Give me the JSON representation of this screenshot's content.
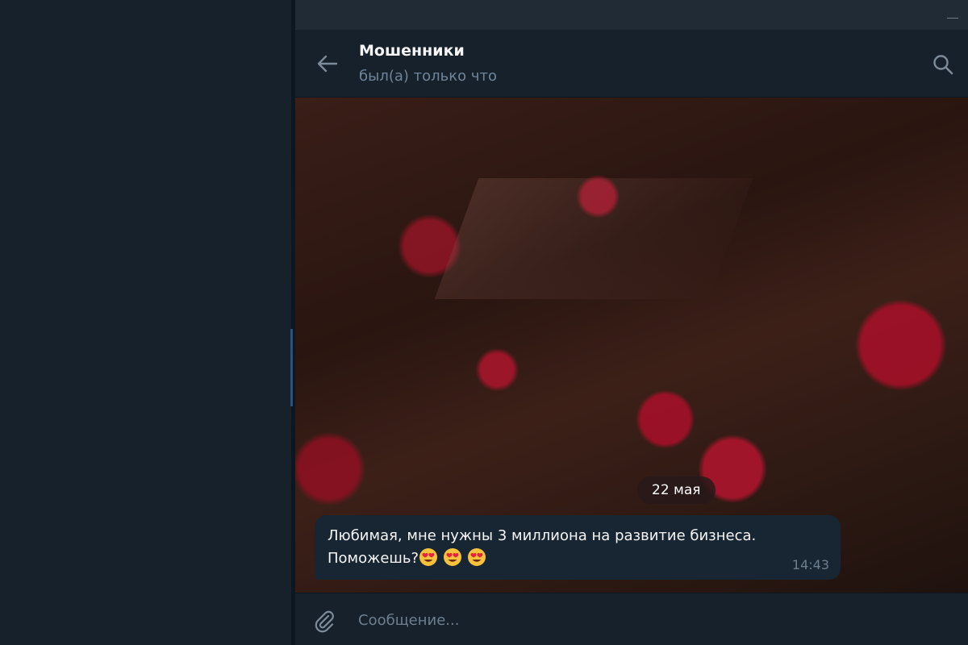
{
  "chat": {
    "title": "Мошенники",
    "status": "был(а) только что"
  },
  "messages": {
    "date_badge": "22 мая",
    "message": {
      "line1": "Любимая, мне нужны 3 миллиона на развитие бизнеса.",
      "line2": "Поможешь?",
      "emojis": [
        "heart-eyes-emoji",
        "heart-eyes-emoji",
        "heart-eyes-emoji"
      ],
      "time": "14:43"
    }
  },
  "composer": {
    "placeholder": "Сообщение..."
  },
  "colors": {
    "background": "#17212b",
    "bubble": "#182533",
    "accent": "#2b5278",
    "muted_text": "#708499"
  }
}
